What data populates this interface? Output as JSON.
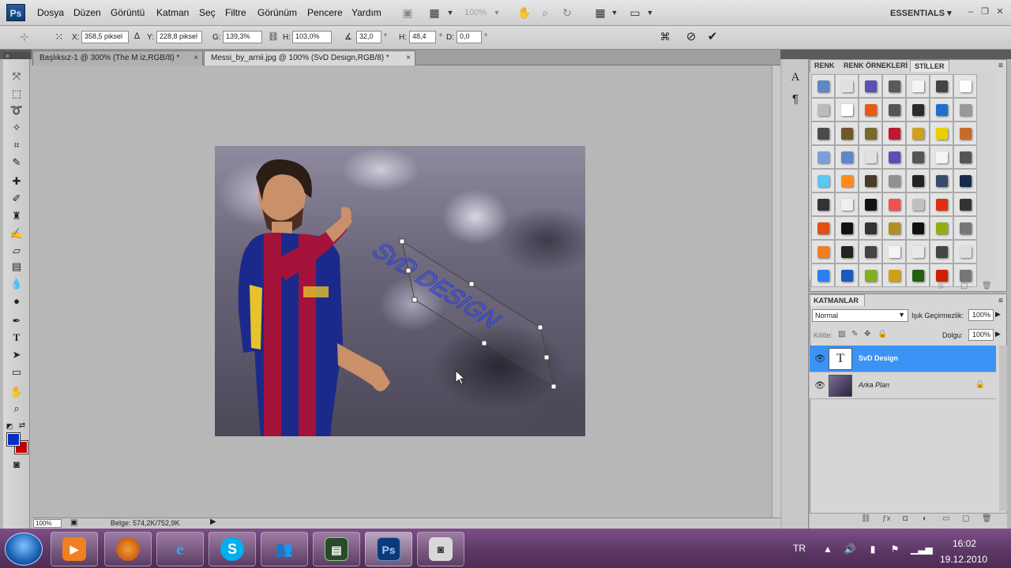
{
  "app": {
    "logo": "Ps",
    "workspace": "ESSENTIALS ▾"
  },
  "menu": [
    "Dosya",
    "Düzen",
    "Görüntü",
    "Katman",
    "Seç",
    "Filtre",
    "Görünüm",
    "Pencere",
    "Yardım"
  ],
  "menubar": {
    "zoom": "100%"
  },
  "options": {
    "x_label": "X:",
    "x_value": "358,5 piksel",
    "y_label": "Y:",
    "y_value": "228,8 piksel",
    "w_label": "G:",
    "w_value": "139,3%",
    "h_label": "H:",
    "h_value": "103,0%",
    "angle_value": "32,0",
    "hskew_label": "H:",
    "hskew_value": "48,4",
    "vskew_label": "D:",
    "vskew_value": "0,0",
    "deg": "°"
  },
  "tabs": [
    {
      "label": "Başlıksız-1 @ 300% (The M  iz,RGB/8) *",
      "close": "×"
    },
    {
      "label": "Messi_by_arnii.jpg @ 100% (SvD Design,RGB/8) *",
      "close": "×"
    }
  ],
  "canvas": {
    "warped_text": "SvD DESIGN"
  },
  "status": {
    "zoom": "100%",
    "doc_info": "Belge: 574,2K/752,9K"
  },
  "styles_panel": {
    "tabs": [
      "RENK",
      "RENK ÖRNEKLERİ",
      "STİLLER"
    ],
    "swatch_colors": [
      "#5e88c6",
      "#e0e0e0",
      "#5a4fb5",
      "#5a5a5a",
      "#f4f4f4",
      "#444444",
      "#ffffff",
      "#bbbbbb",
      "#ffffff",
      "#e85a10",
      "#555555",
      "#2b2b2b",
      "#1f6fd0",
      "#999999",
      "#4a4a4a",
      "#6d5a2a",
      "#7a6a2a",
      "#c01830",
      "#d0a020",
      "#e8d000",
      "#c86a2a",
      "#7aa0d8",
      "#5e88c6",
      "#e0e0e0",
      "#5a4fb5",
      "#555555",
      "#f4f4f4",
      "#555555",
      "#5ac8f0",
      "#ff8a20",
      "#4a3a2a",
      "#909090",
      "#222222",
      "#3a4a6a",
      "#1a2a4a",
      "#333333",
      "#eeeeee",
      "#111111",
      "#f05050",
      "#c0c0c0",
      "#e03010",
      "#333333",
      "#e05010",
      "#111111",
      "#333333",
      "#b09020",
      "#111111",
      "#90b010",
      "#777777",
      "#f08020",
      "#222222",
      "#444444",
      "#f4f4f4",
      "#e8e8e8",
      "#444444",
      "#dddddd",
      "#2a80f0",
      "#1a5ac0",
      "#80b020",
      "#d0a010",
      "#206010",
      "#d02000",
      "#777777"
    ]
  },
  "layers_panel": {
    "title": "KATMANLAR",
    "blend_mode": "Normal",
    "opacity_label": "Işık Geçirmezlik:",
    "opacity_value": "100%",
    "lock_label": "Kilitle:",
    "fill_label": "Dolgu:",
    "fill_value": "100%",
    "layers": [
      {
        "name": "SvD Design",
        "thumb": "T"
      },
      {
        "name": "Arka Plan"
      }
    ]
  },
  "taskbar": {
    "apps": [
      "media-player",
      "firefox",
      "internet-explorer",
      "skype",
      "messenger",
      "terminal",
      "photoshop",
      "camera"
    ],
    "photoshop_label": "Ps",
    "lang": "TR",
    "time": "16:02",
    "date": "19.12.2010"
  }
}
